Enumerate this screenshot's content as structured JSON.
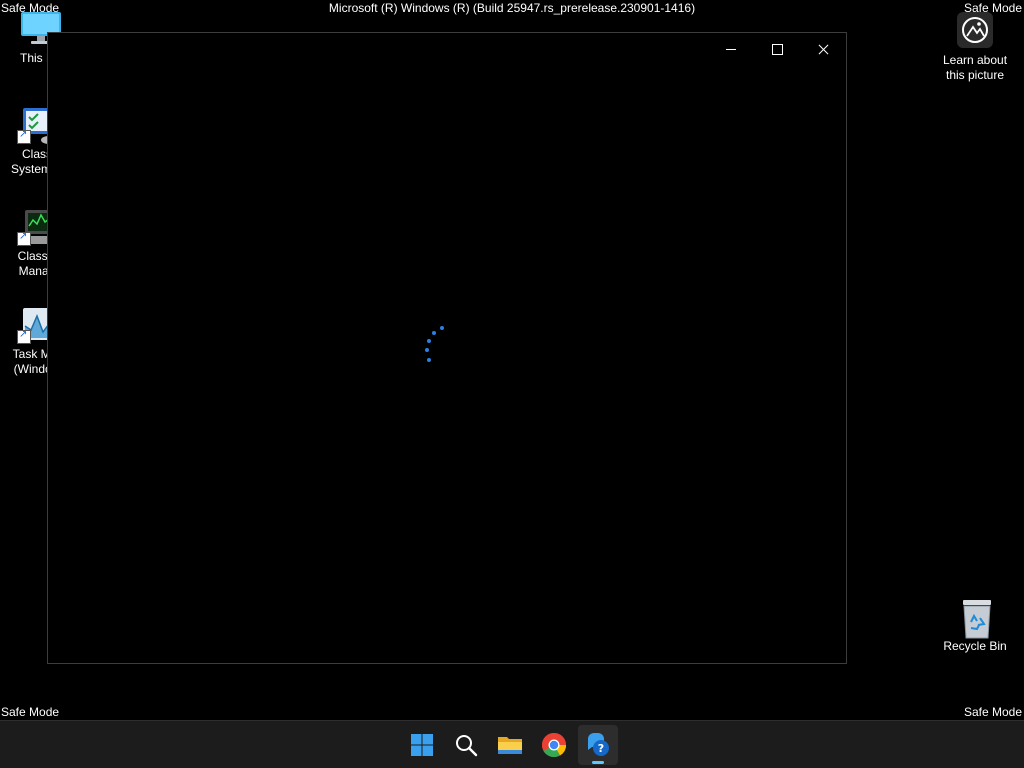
{
  "system": {
    "safe_mode_label": "Safe Mode",
    "build_string": "Microsoft (R) Windows (R) (Build 25947.rs_prerelease.230901-1416)"
  },
  "desktop": {
    "icons": [
      {
        "label": "This PC",
        "visible_label": "This P",
        "icon": "monitor-icon"
      },
      {
        "label": "Classic System Configuration",
        "visible_label": "Class\nSystem C",
        "icon": "system-config-icon"
      },
      {
        "label": "Classic Manager",
        "visible_label": "Classic\nManag",
        "icon": "classic-manager-icon"
      },
      {
        "label": "Task Manager (Windows)",
        "visible_label": "Task Mar\n(Window",
        "icon": "task-manager-icon"
      },
      {
        "label": "Learn about this picture",
        "visible_label": "Learn about\nthis picture",
        "icon": "camera-icon"
      },
      {
        "label": "Recycle Bin",
        "visible_label": "Recycle Bin",
        "icon": "recycle-bin-icon"
      }
    ]
  },
  "window": {
    "state": "loading",
    "controls": [
      "minimize",
      "maximize",
      "close"
    ]
  },
  "taskbar": {
    "apps": [
      {
        "name": "Start",
        "icon": "windows-start-icon",
        "active": false
      },
      {
        "name": "Search",
        "icon": "search-icon",
        "active": false
      },
      {
        "name": "File Explorer",
        "icon": "folder-icon",
        "active": false
      },
      {
        "name": "Google Chrome",
        "icon": "chrome-icon",
        "active": false
      },
      {
        "name": "Get Help",
        "icon": "help-icon",
        "active": true
      }
    ]
  },
  "colors": {
    "spinner": "#2a80e0",
    "taskbar": "#1c1c1c",
    "active_indicator": "#5cc8ff"
  }
}
